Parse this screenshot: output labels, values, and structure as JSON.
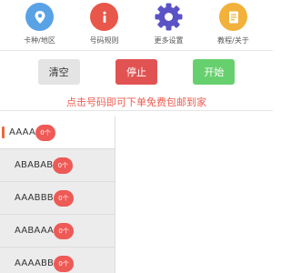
{
  "top_nav": {
    "items": [
      {
        "label": "卡种/地区",
        "icon": "location-pin-icon",
        "color": "#5aa2e6"
      },
      {
        "label": "号码规则",
        "icon": "info-icon",
        "color": "#e8574a"
      },
      {
        "label": "更多设置",
        "icon": "gear-icon",
        "color": "#5b52c6"
      },
      {
        "label": "教程/关于",
        "icon": "document-icon",
        "color": "#f2b13a"
      }
    ]
  },
  "controls": {
    "clear_label": "清空",
    "stop_label": "停止",
    "start_label": "开始"
  },
  "notice": "点击号码即可下单免费包邮到家",
  "patterns": [
    {
      "name": "AAAA",
      "count": "0个",
      "active": true
    },
    {
      "name": "ABABAB",
      "count": "0个",
      "active": false
    },
    {
      "name": "AAABBB",
      "count": "0个",
      "active": false
    },
    {
      "name": "AABAAA",
      "count": "0个",
      "active": false
    },
    {
      "name": "AAAABB",
      "count": "0个",
      "active": false
    }
  ],
  "colors": {
    "accent_red": "#ee5a56",
    "start_green": "#66d06e",
    "active_marker": "#e76b3c"
  }
}
